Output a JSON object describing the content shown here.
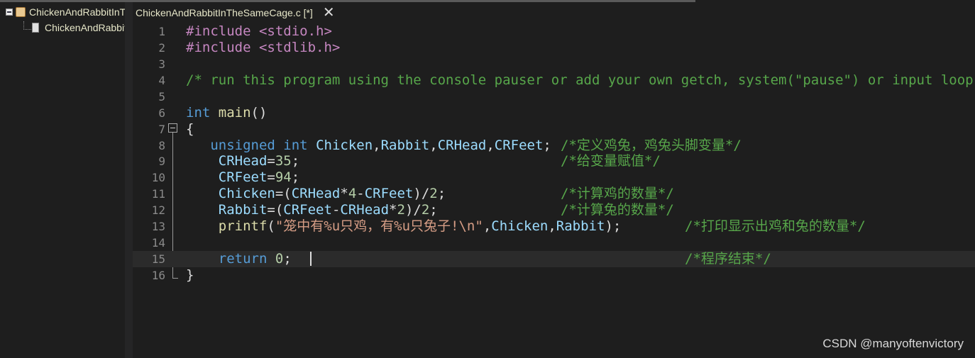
{
  "sidebar": {
    "project": "ChickenAndRabbitInTheSameCage",
    "file": "ChickenAndRabbitInTheSameCage.c"
  },
  "tab": {
    "label": "ChickenAndRabbitInTheSameCage.c [*]",
    "close": "✕"
  },
  "editor": {
    "current_line": 15,
    "lines": [
      {
        "n": "1",
        "tokens": [
          [
            "pp",
            "#include <stdio.h>"
          ]
        ]
      },
      {
        "n": "2",
        "tokens": [
          [
            "pp",
            "#include <stdlib.h>"
          ]
        ]
      },
      {
        "n": "3",
        "tokens": []
      },
      {
        "n": "4",
        "tokens": [
          [
            "cm",
            "/* run this program using the console pauser or add your own getch, system(\"pause\") or input loop */"
          ]
        ]
      },
      {
        "n": "5",
        "tokens": []
      },
      {
        "n": "6",
        "tokens": [
          [
            "kw",
            "int"
          ],
          [
            "op",
            " "
          ],
          [
            "fn",
            "main"
          ],
          [
            "op",
            "()"
          ]
        ]
      },
      {
        "n": "7",
        "tokens": [
          [
            "op",
            "{"
          ]
        ]
      },
      {
        "n": "8",
        "tokens": [
          [
            "op",
            "   "
          ],
          [
            "kw",
            "unsigned int"
          ],
          [
            "op",
            " "
          ],
          [
            "id",
            "Chicken"
          ],
          [
            "op",
            ","
          ],
          [
            "id",
            "Rabbit"
          ],
          [
            "op",
            ","
          ],
          [
            "id",
            "CRHead"
          ],
          [
            "op",
            ","
          ],
          [
            "id",
            "CRFeet"
          ],
          [
            "op",
            ";"
          ]
        ],
        "comment": "/*定义鸡兔，鸡兔头脚变量*/"
      },
      {
        "n": "9",
        "tokens": [
          [
            "op",
            "    "
          ],
          [
            "id",
            "CRHead"
          ],
          [
            "op",
            "="
          ],
          [
            "num",
            "35"
          ],
          [
            "op",
            ";"
          ]
        ],
        "comment": "/*给变量赋值*/"
      },
      {
        "n": "10",
        "tokens": [
          [
            "op",
            "    "
          ],
          [
            "id",
            "CRFeet"
          ],
          [
            "op",
            "="
          ],
          [
            "num",
            "94"
          ],
          [
            "op",
            ";"
          ]
        ]
      },
      {
        "n": "11",
        "tokens": [
          [
            "op",
            "    "
          ],
          [
            "id",
            "Chicken"
          ],
          [
            "op",
            "=("
          ],
          [
            "id",
            "CRHead"
          ],
          [
            "op",
            "*"
          ],
          [
            "num",
            "4"
          ],
          [
            "op",
            "-"
          ],
          [
            "id",
            "CRFeet"
          ],
          [
            "op",
            ")/"
          ],
          [
            "num",
            "2"
          ],
          [
            "op",
            ";"
          ]
        ],
        "comment": "/*计算鸡的数量*/"
      },
      {
        "n": "12",
        "tokens": [
          [
            "op",
            "    "
          ],
          [
            "id",
            "Rabbit"
          ],
          [
            "op",
            "=("
          ],
          [
            "id",
            "CRFeet"
          ],
          [
            "op",
            "-"
          ],
          [
            "id",
            "CRHead"
          ],
          [
            "op",
            "*"
          ],
          [
            "num",
            "2"
          ],
          [
            "op",
            ")/"
          ],
          [
            "num",
            "2"
          ],
          [
            "op",
            ";"
          ]
        ],
        "comment": "/*计算兔的数量*/"
      },
      {
        "n": "13",
        "tokens": [
          [
            "op",
            "    "
          ],
          [
            "fn",
            "printf"
          ],
          [
            "op",
            "("
          ],
          [
            "str",
            "\"笼中有%u只鸡，有%u只兔子!\\n\""
          ],
          [
            "op",
            ","
          ],
          [
            "id",
            "Chicken"
          ],
          [
            "op",
            ","
          ],
          [
            "id",
            "Rabbit"
          ],
          [
            "op",
            ");"
          ]
        ],
        "comment": "/*打印显示出鸡和兔的数量*/"
      },
      {
        "n": "14",
        "tokens": []
      },
      {
        "n": "15",
        "tokens": [
          [
            "op",
            "    "
          ],
          [
            "kw",
            "return"
          ],
          [
            "op",
            " "
          ],
          [
            "num",
            "0"
          ],
          [
            "op",
            ";"
          ]
        ],
        "comment": "/*程序结束*/"
      },
      {
        "n": "16",
        "tokens": [
          [
            "op",
            "}"
          ]
        ]
      }
    ]
  },
  "watermark": "CSDN @manyoftenvictory"
}
